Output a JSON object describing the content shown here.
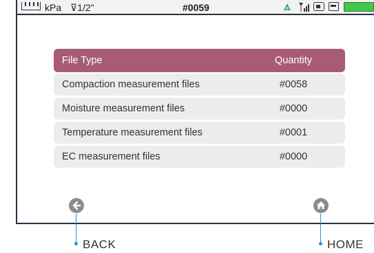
{
  "status_bar": {
    "unit": "kPa",
    "diameter": "⊽1/2”",
    "record_id": "#0059",
    "icons": [
      "ruler-icon",
      "gps-icon",
      "signal-icon",
      "sd-card-icon",
      "printer-icon",
      "battery-icon"
    ]
  },
  "table": {
    "header": {
      "name": "File Type",
      "quantity": "Quantity"
    },
    "rows": [
      {
        "name": "Compaction measurement files",
        "quantity": "#0058"
      },
      {
        "name": "Moisture measurement files",
        "quantity": "#0000"
      },
      {
        "name": "Temperature measurement files",
        "quantity": "#0001"
      },
      {
        "name": "EC measurement files",
        "quantity": "#0000"
      }
    ]
  },
  "buttons": {
    "back_icon": "back-arrow-icon",
    "home_icon": "home-icon"
  },
  "callouts": {
    "back": "BACK",
    "home": "HOME"
  },
  "colors": {
    "header_bg": "#a85b74",
    "row_bg": "#ececec",
    "frame": "#2b2f40",
    "callout": "#2a8fd0",
    "battery": "#43c64a"
  }
}
